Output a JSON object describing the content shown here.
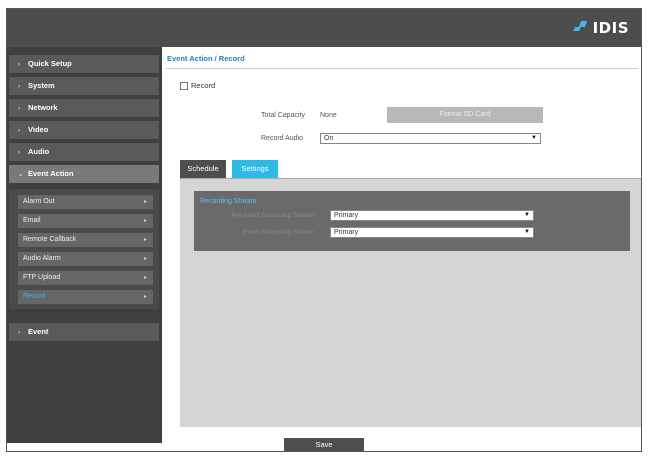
{
  "header": {
    "logo_text": "IDIS",
    "accent_color": "#3fb7e8"
  },
  "sidebar": {
    "items": [
      {
        "label": "Quick Setup"
      },
      {
        "label": "System"
      },
      {
        "label": "Network"
      },
      {
        "label": "Video"
      },
      {
        "label": "Audio"
      },
      {
        "label": "Event Action"
      },
      {
        "label": "Event"
      }
    ],
    "sub_items": [
      {
        "label": "Alarm Out"
      },
      {
        "label": "Email"
      },
      {
        "label": "Remote Callback"
      },
      {
        "label": "Audio Alarm"
      },
      {
        "label": "FTP Upload"
      },
      {
        "label": "Record"
      }
    ]
  },
  "content": {
    "breadcrumb": "Event Action / Record",
    "record_label": "Record",
    "total_capacity_label": "Total Capacity",
    "total_capacity_value": "None",
    "format_button": "Format SD Card",
    "record_audio_label": "Record Audio",
    "record_audio_value": "On",
    "tabs": {
      "schedule": "Schedule",
      "settings": "Settings"
    },
    "settings": {
      "title": "Recording Stream",
      "row1_label": "Pre-event Recording Stream",
      "row1_value": "Primary",
      "row2_label": "Event Recording Stream",
      "row2_value": "Primary"
    }
  },
  "footer": {
    "save_label": "Save"
  }
}
